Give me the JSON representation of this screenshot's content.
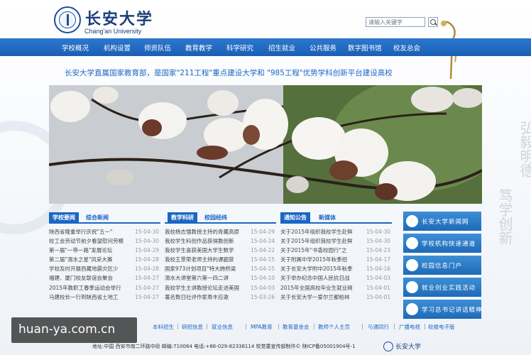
{
  "header": {
    "brand": "长安大学",
    "brand_en": "Chang'an University",
    "search_placeholder": "请输入关键字"
  },
  "nav": {
    "items": [
      "学校概况",
      "机构设置",
      "师资队伍",
      "教育教学",
      "科学研究",
      "招生就业",
      "公共服务",
      "数字图书馆",
      "校友总会"
    ]
  },
  "slogan": "长安大学直属国家教育部，是国家\"211工程\"重点建设大学和 \"985工程\"优势学科创新平台建设高校",
  "calligraphy": {
    "col1": "弘毅明德",
    "col2": "笃学创新"
  },
  "panels": [
    {
      "tabs": [
        "学校要闻",
        "综合新闻"
      ],
      "items": [
        {
          "title": "陕西省隆重举行庆祝\"五一\"",
          "date": "15-04-30"
        },
        {
          "title": "校工会劳动节前夕看望慰问劳模",
          "date": "15-04-30"
        },
        {
          "title": "第一届\"一带一路\"发展论坛",
          "date": "15-04-29"
        },
        {
          "title": "第二届\"渭水之星\"风采大赛",
          "date": "15-04-28"
        },
        {
          "title": "学校及时开展西藏地震灾区少",
          "date": "15-04-28"
        },
        {
          "title": "福建、厦门校友联谊会聚会",
          "date": "15-04-27"
        },
        {
          "title": "2015年教职工春季运动会举行",
          "date": "15-04-27"
        },
        {
          "title": "马建校长一行到陕西省土地工",
          "date": "15-04-27"
        }
      ]
    },
    {
      "tabs": [
        "教学科研",
        "校园经纬"
      ],
      "items": [
        {
          "title": "我校杨志强教授主持的青藏高原",
          "date": "15-04-29"
        },
        {
          "title": "我校学生科创作品获得教创新",
          "date": "15-04-24"
        },
        {
          "title": "我校学生喜获美国大学生数学",
          "date": "15-04-22"
        },
        {
          "title": "我校王景荣老师主持的课题获",
          "date": "15-04-15"
        },
        {
          "title": "国家973计划项目\"特大跨桥梁",
          "date": "15-04-15"
        },
        {
          "title": "渭水大讲堂第六第一四二讲",
          "date": "15-04-10"
        },
        {
          "title": "我校学生主讲教授论坛走进美国",
          "date": "15-04-03"
        },
        {
          "title": "著名数日社评作家寿丰应邀",
          "date": "15-03-26"
        }
      ]
    },
    {
      "tabs": [
        "通知公告",
        "新媒体"
      ],
      "items": [
        {
          "title": "关于2015年组织我校学生赴鲜",
          "date": "15-04-30"
        },
        {
          "title": "关于2015年组织我校学生赴鲜",
          "date": "15-04-30"
        },
        {
          "title": "关于2015年\"书香校园行\"之",
          "date": "15-04-23"
        },
        {
          "title": "关于附属中学2015年秋季招",
          "date": "15-04-17"
        },
        {
          "title": "关于长安大学附中2015年秋季",
          "date": "15-04-16"
        },
        {
          "title": "关于举办纪念中国人民抗日战",
          "date": "15-04-03"
        },
        {
          "title": "2015年全国高校毕业生就业网",
          "date": "15-04-01"
        },
        {
          "title": "关于长安大学一爱尔兰都柏林",
          "date": "15-04-01"
        }
      ]
    }
  ],
  "quick_links": [
    {
      "label": "长安大学新闻网",
      "icon": "grid-icon"
    },
    {
      "label": "学校机构快速通道",
      "icon": "gear-icon"
    },
    {
      "label": "校园信息门户",
      "icon": "globe-icon"
    },
    {
      "label": "就业创业实践活动",
      "icon": "people-icon"
    },
    {
      "label": "学习总书记讲话精神",
      "icon": "flag-icon"
    }
  ],
  "bottom_links": [
    "本科招生",
    "研招信息",
    "就业信息",
    "MPA教育",
    "教育基金会",
    "教师个人主页",
    "与通同行",
    "广播电视",
    "校报电子版"
  ],
  "footer": {
    "address": "地址:中国 西安市南二环路中段 邮编:710064 电话:+86-029-82338114 校党委宣传部制作© 陕ICP备05001904号-1",
    "brand": "长安大学"
  },
  "watermark": "huan-ya.com.cn",
  "colors": {
    "accent": "#1a66c3",
    "nav": "#2a72c8",
    "quick": "#2f80cc"
  }
}
